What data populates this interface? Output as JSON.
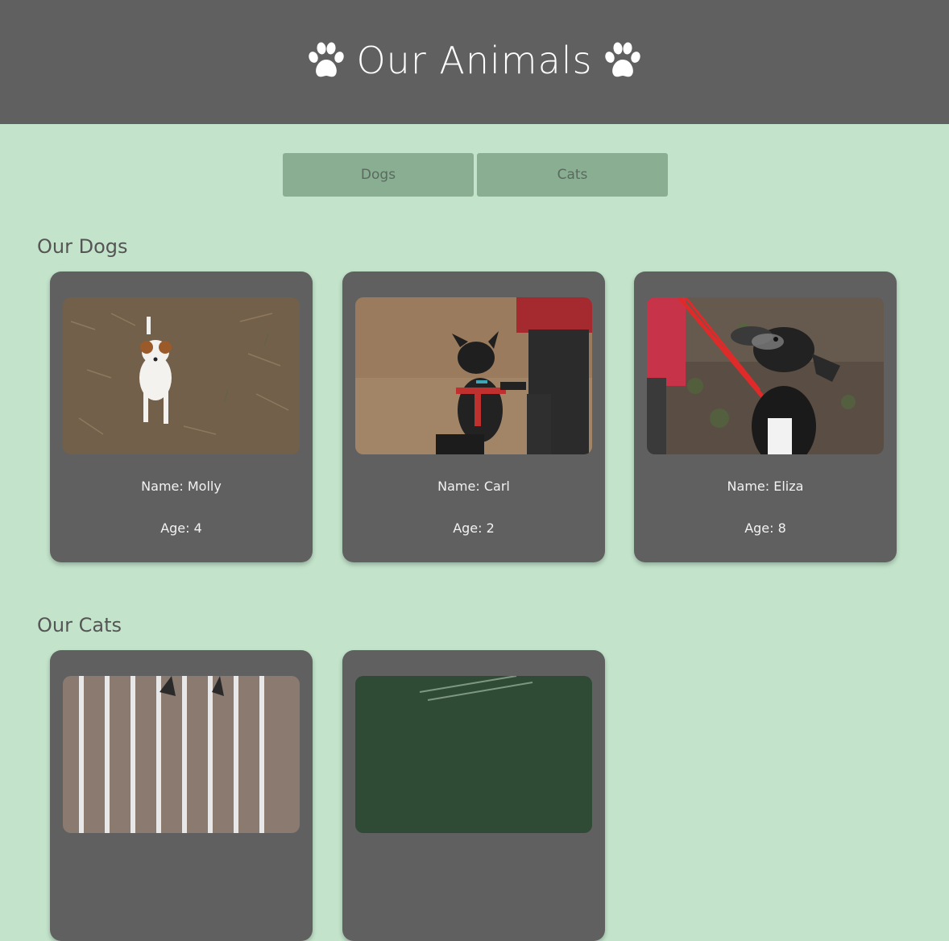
{
  "header": {
    "title": "Our Animals",
    "left_icon": "paw-icon",
    "right_icon": "paw-icon"
  },
  "tabs": [
    {
      "label": "Dogs"
    },
    {
      "label": "Cats"
    }
  ],
  "sections": {
    "dogs_title": "Our Dogs",
    "cats_title": "Our Cats"
  },
  "dogs": [
    {
      "name": "Name: Molly",
      "age": "Age: 4"
    },
    {
      "name": "Name: Carl",
      "age": "Age: 2"
    },
    {
      "name": "Name: Eliza",
      "age": "Age: 8"
    }
  ],
  "colors": {
    "header_bg": "#606060",
    "page_bg": "#c3e4cb",
    "tab_bg": "#8aae92",
    "card_bg": "#606060"
  }
}
